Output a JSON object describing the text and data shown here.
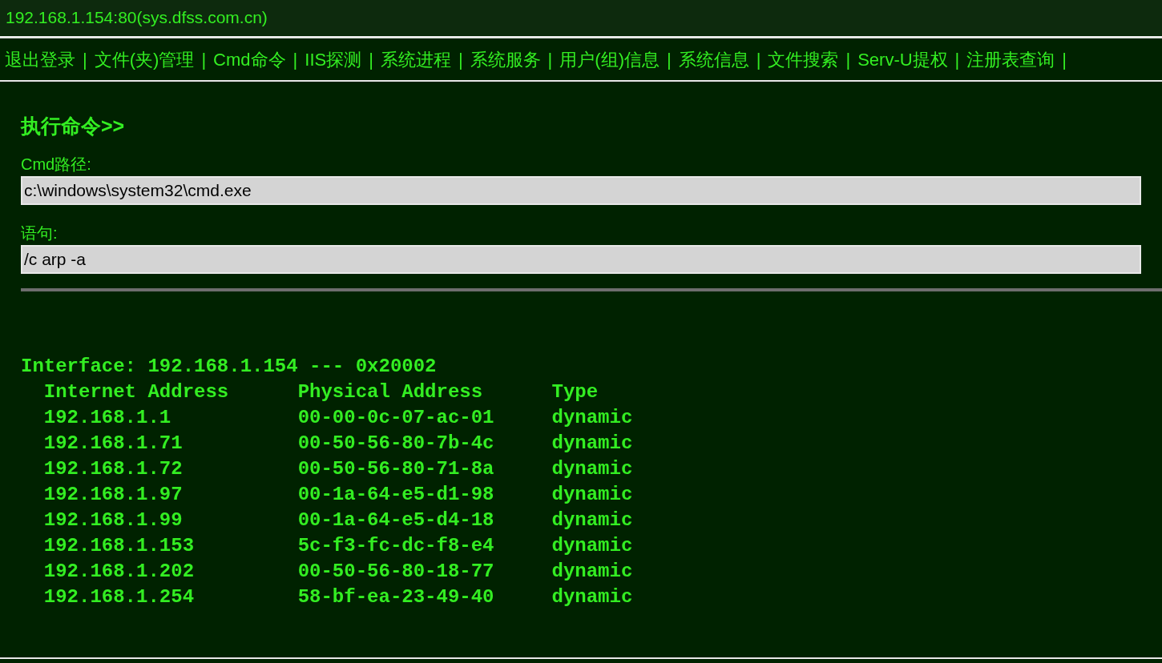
{
  "header": {
    "title": "192.168.1.154:80(sys.dfss.com.cn)"
  },
  "nav": {
    "separator": "|",
    "items": [
      {
        "label": "退出登录"
      },
      {
        "label": "文件(夹)管理"
      },
      {
        "label": "Cmd命令"
      },
      {
        "label": "IIS探测"
      },
      {
        "label": "系统进程"
      },
      {
        "label": "系统服务"
      },
      {
        "label": "用户(组)信息"
      },
      {
        "label": "系统信息"
      },
      {
        "label": "文件搜索"
      },
      {
        "label": "Serv-U提权"
      },
      {
        "label": "注册表查询"
      }
    ]
  },
  "section_title": "执行命令>>",
  "form": [
    {
      "label": "Cmd路径:",
      "value": "c:\\windows\\system32\\cmd.exe"
    },
    {
      "label": "语句:",
      "value": "/c arp -a"
    }
  ],
  "output": [
    "Interface: 192.168.1.154 --- 0x20002",
    "  Internet Address      Physical Address      Type",
    "  192.168.1.1           00-00-0c-07-ac-01     dynamic",
    "  192.168.1.71          00-50-56-80-7b-4c     dynamic",
    "  192.168.1.72          00-50-56-80-71-8a     dynamic",
    "  192.168.1.97          00-1a-64-e5-d1-98     dynamic",
    "  192.168.1.99          00-1a-64-e5-d4-18     dynamic",
    "  192.168.1.153         5c-f3-fc-dc-f8-e4     dynamic",
    "  192.168.1.202         00-50-56-80-18-77     dynamic",
    "  192.168.1.254         58-bf-ea-23-49-40     dynamic"
  ]
}
